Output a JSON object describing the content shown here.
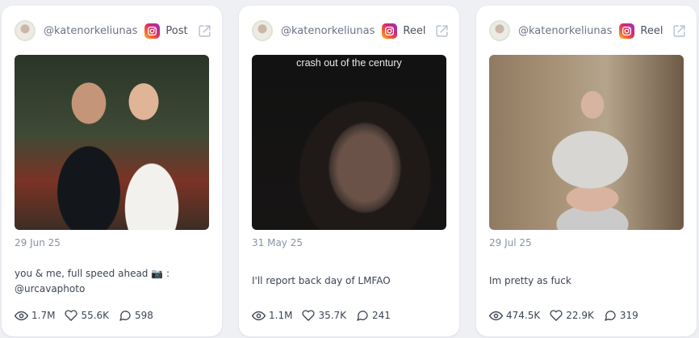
{
  "posts": [
    {
      "username": "@katenorkeliunas",
      "type": "Post",
      "date": "29 Jun 25",
      "caption": "you & me, full speed ahead 📷 : @urcavaphoto",
      "overlay_text": "",
      "views": "1.7M",
      "likes": "55.6K",
      "comments": "598"
    },
    {
      "username": "@katenorkeliunas",
      "type": "Reel",
      "date": "31 May 25",
      "caption": "I'll report back day of LMFAO",
      "overlay_text": "crash out of the century",
      "views": "1.1M",
      "likes": "35.7K",
      "comments": "241"
    },
    {
      "username": "@katenorkeliunas",
      "type": "Reel",
      "date": "29 Jul 25",
      "caption": "Im pretty as fuck",
      "overlay_text": "",
      "views": "474.5K",
      "likes": "22.9K",
      "comments": "319"
    }
  ],
  "icons": {
    "platform": "instagram-icon",
    "external": "external-link-icon",
    "views": "eye-icon",
    "likes": "heart-icon",
    "comments": "comment-icon"
  },
  "colors": {
    "background": "#eef0f4",
    "card": "#ffffff",
    "muted_text": "#8a91a3",
    "body_text": "#3d4454"
  }
}
